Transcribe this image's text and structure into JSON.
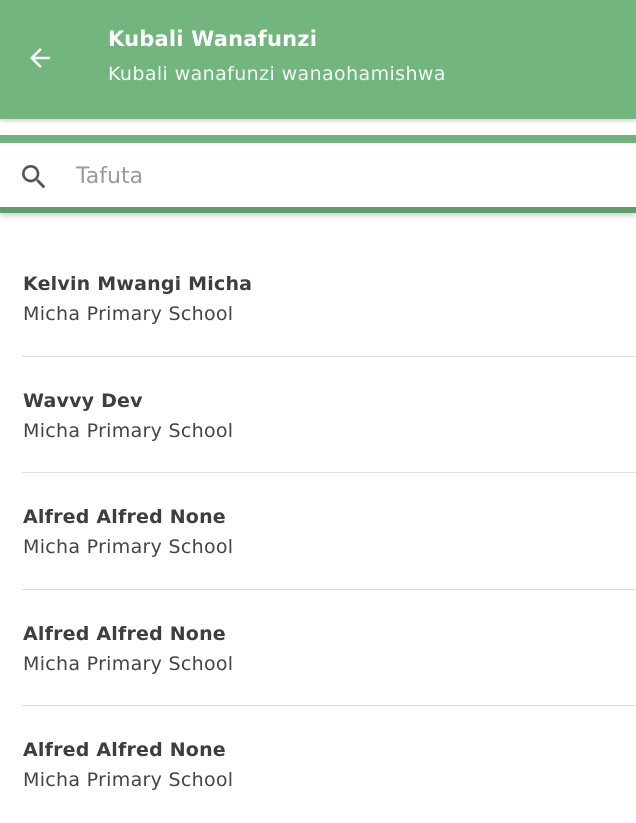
{
  "header": {
    "title": "Kubali Wanafunzi",
    "subtitle": "Kubali wanafunzi wanaohamishwa",
    "back_icon": "arrow-left-icon",
    "color": "#72b57f"
  },
  "search": {
    "placeholder": "Tafuta",
    "value": "",
    "icon": "search-icon"
  },
  "students": [
    {
      "name": "Kelvin Mwangi Micha",
      "school": "Micha Primary School"
    },
    {
      "name": "Wavvy Dev",
      "school": "Micha Primary School"
    },
    {
      "name": "Alfred Alfred None",
      "school": "Micha Primary School"
    },
    {
      "name": "Alfred Alfred None",
      "school": "Micha Primary School"
    },
    {
      "name": "Alfred Alfred None",
      "school": "Micha Primary School"
    }
  ]
}
